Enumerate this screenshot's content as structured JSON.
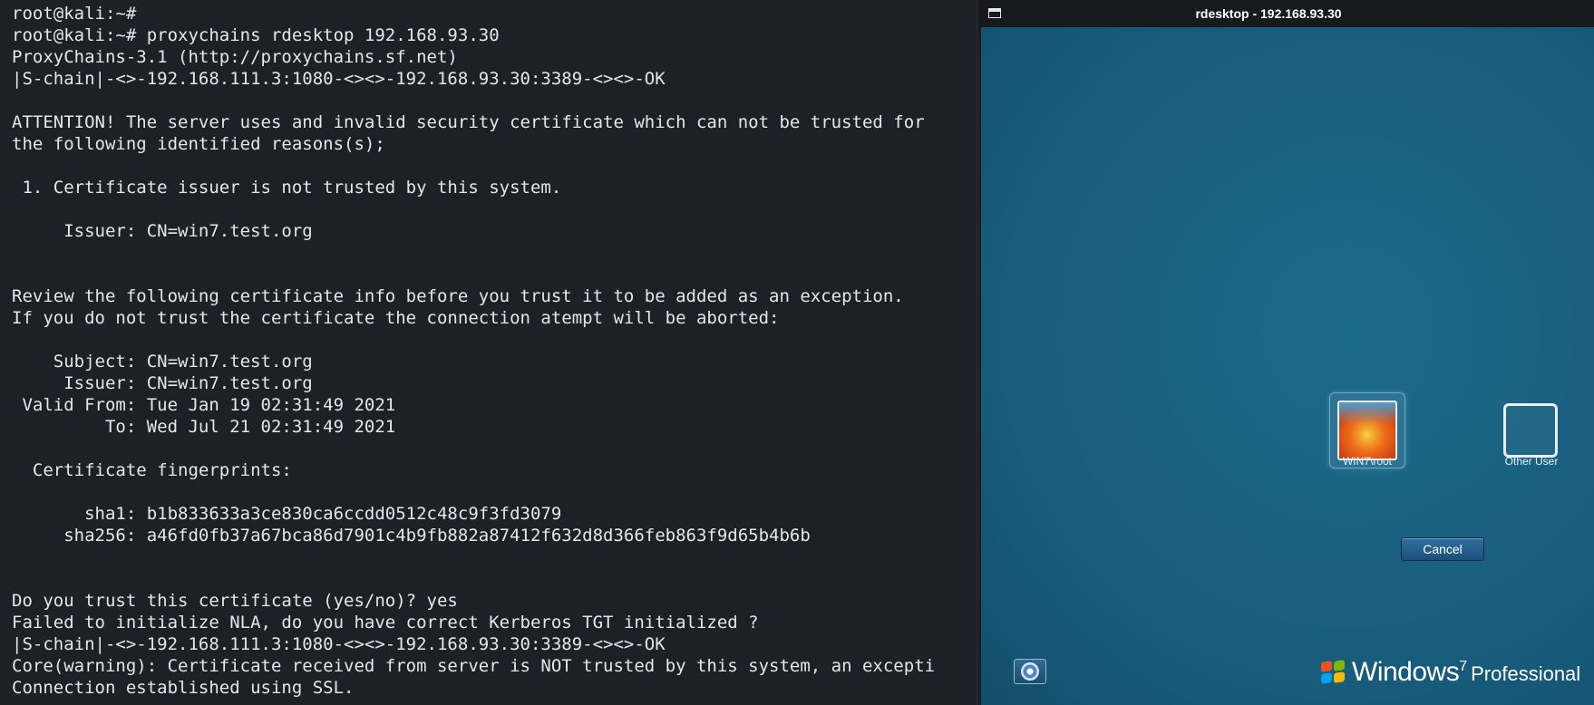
{
  "terminal": {
    "lines": [
      "root@kali:~#",
      "root@kali:~# proxychains rdesktop 192.168.93.30",
      "ProxyChains-3.1 (http://proxychains.sf.net)",
      "|S-chain|-<>-192.168.111.3:1080-<><>-192.168.93.30:3389-<><>-OK",
      "",
      "ATTENTION! The server uses and invalid security certificate which can not be trusted for",
      "the following identified reasons(s);",
      "",
      " 1. Certificate issuer is not trusted by this system.",
      "",
      "     Issuer: CN=win7.test.org",
      "",
      "",
      "Review the following certificate info before you trust it to be added as an exception.",
      "If you do not trust the certificate the connection atempt will be aborted:",
      "",
      "    Subject: CN=win7.test.org",
      "     Issuer: CN=win7.test.org",
      " Valid From: Tue Jan 19 02:31:49 2021",
      "         To: Wed Jul 21 02:31:49 2021",
      "",
      "  Certificate fingerprints:",
      "",
      "       sha1: b1b833633a3ce830ca6ccdd0512c48c9f3fd3079",
      "     sha256: a46fd0fb37a67bca86d7901c4b9fb882a87412f632d8d366feb863f9d65b4b6b",
      "",
      "",
      "Do you trust this certificate (yes/no)? yes",
      "Failed to initialize NLA, do you have correct Kerberos TGT initialized ?",
      "|S-chain|-<>-192.168.111.3:1080-<><>-192.168.93.30:3389-<><>-OK",
      "Core(warning): Certificate received from server is NOT trusted by this system, an excepti",
      "Connection established using SSL."
    ]
  },
  "rdesktop": {
    "title": "rdesktop - 192.168.93.30",
    "users": [
      {
        "label": "WIN7\\root"
      },
      {
        "label": "Other User"
      }
    ],
    "cancel_label": "Cancel",
    "branding": {
      "windows": "Windows",
      "version": "7",
      "edition": "Professional"
    }
  },
  "colors": {
    "terminal_bg": "#1e2027",
    "terminal_text": "#e6e6e6",
    "desktop_bg": "#195f7f"
  }
}
